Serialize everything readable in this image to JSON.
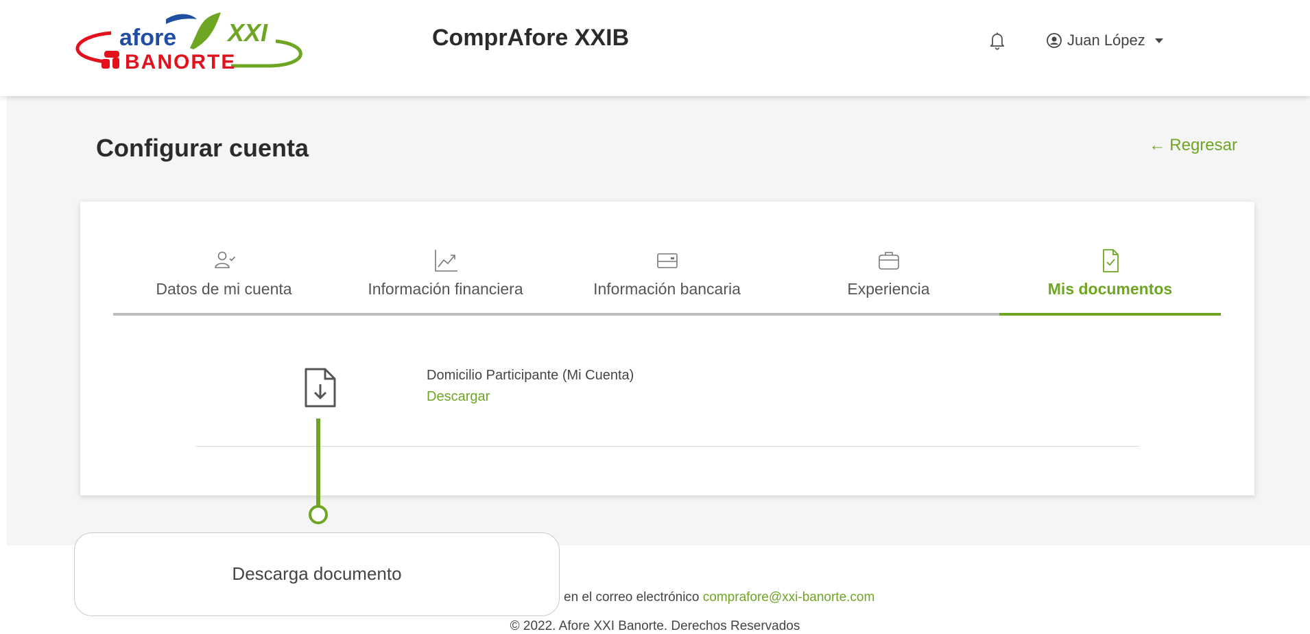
{
  "header": {
    "logo_top": "afore",
    "logo_xxi": "XXI",
    "logo_bottom": "BANORTE",
    "app_title": "ComprAfore XXIB",
    "user_name": "Juan López"
  },
  "page": {
    "title": "Configurar cuenta",
    "back_label": "Regresar",
    "back_arrow": "←"
  },
  "tabs": [
    {
      "label": "Datos de mi cuenta",
      "icon": "user-check-icon",
      "active": false
    },
    {
      "label": "Información financiera",
      "icon": "chart-line-icon",
      "active": false
    },
    {
      "label": "Información bancaria",
      "icon": "card-icon",
      "active": false
    },
    {
      "label": "Experiencia",
      "icon": "briefcase-icon",
      "active": false
    },
    {
      "label": "Mis documentos",
      "icon": "document-check-icon",
      "active": true
    }
  ],
  "document": {
    "name": "Domicilio Participante (Mi Cuenta)",
    "action": "Descargar"
  },
  "callout": {
    "text": "Descarga documento"
  },
  "footer": {
    "contact_prefix": "en el correo electrónico",
    "email": "comprafore@xxi-banorte.com",
    "copyright": "© 2022. Afore XXI Banorte. Derechos Reservados"
  },
  "colors": {
    "accent": "#6ea523",
    "brand_red": "#e3101d",
    "brand_blue": "#1f4ea3"
  }
}
